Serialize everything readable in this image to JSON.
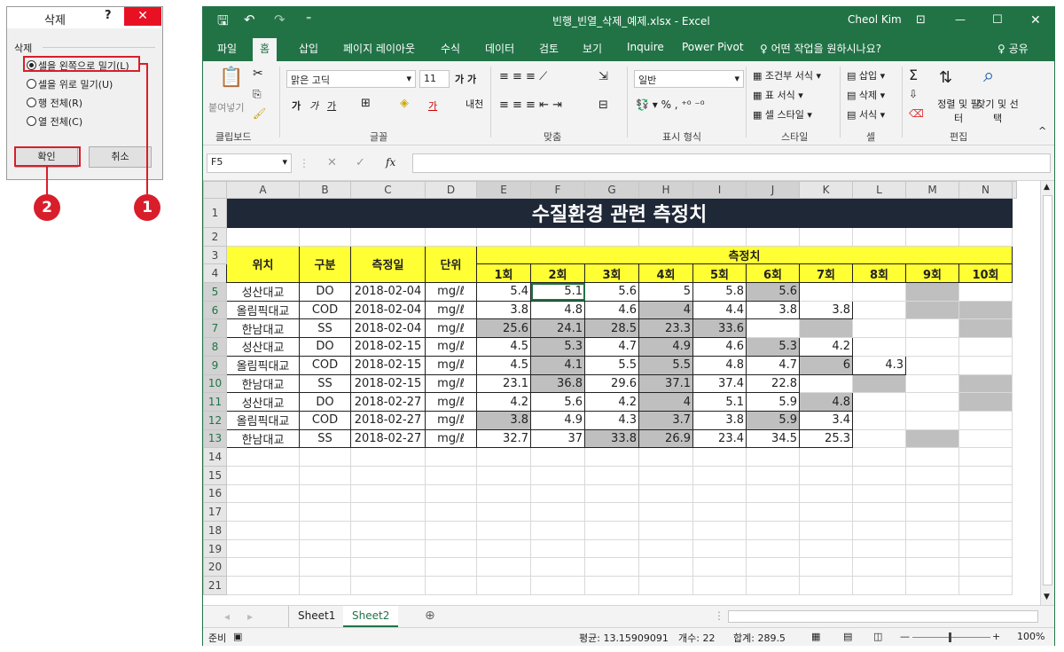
{
  "dialog": {
    "title": "삭제",
    "help": "?",
    "close": "✕",
    "group": "삭제",
    "options": [
      {
        "label": "셀을 왼쪽으로 밀기(L)",
        "selected": true
      },
      {
        "label": "셀을 위로 밀기(U)",
        "selected": false
      },
      {
        "label": "행 전체(R)",
        "selected": false
      },
      {
        "label": "열 전체(C)",
        "selected": false
      }
    ],
    "ok": "확인",
    "cancel": "취소"
  },
  "callouts": {
    "one": "1",
    "two": "2"
  },
  "app": {
    "title": "빈행_빈열_삭제_예제.xlsx  -  Excel",
    "user": "Cheol Kim"
  },
  "tabs": [
    "파일",
    "홈",
    "삽입",
    "페이지 레이아웃",
    "수식",
    "데이터",
    "검토",
    "보기",
    "Inquire",
    "Power Pivot",
    "♀ 어떤 작업을 원하시나요?"
  ],
  "share": "♀ 공유",
  "ribbon": {
    "clipboard": {
      "paste": "붙여넣기",
      "label": "클립보드"
    },
    "font": {
      "name": "맑은 고딕",
      "size": "11",
      "label": "글꼴"
    },
    "align": {
      "label": "맞춤"
    },
    "number": {
      "format": "일반",
      "label": "표시 형식"
    },
    "styles": {
      "conditional": "조건부 서식",
      "table": "표 서식",
      "cell": "셀 스타일",
      "label": "스타일"
    },
    "cells": {
      "insert": "삽입",
      "delete": "삭제",
      "format": "서식",
      "label": "셀"
    },
    "edit": {
      "sort": "정렬 및 필터",
      "find": "찾기 및 선택",
      "label": "편집"
    }
  },
  "formula": {
    "namebox": "F5",
    "value": ""
  },
  "columns": [
    "A",
    "B",
    "C",
    "D",
    "E",
    "F",
    "G",
    "H",
    "I",
    "J",
    "K",
    "L",
    "M",
    "N"
  ],
  "sheet": {
    "title": "수질환경 관련 측정치",
    "headers": {
      "loc": "위치",
      "type": "구분",
      "date": "측정일",
      "unit": "단위",
      "group": "측정치",
      "rounds": [
        "1회",
        "2회",
        "3회",
        "4회",
        "5회",
        "6회",
        "7회",
        "8회",
        "9회",
        "10회"
      ]
    },
    "rows": [
      {
        "loc": "성산대교",
        "type": "DO",
        "date": "2018-02-04",
        "unit": "mg/ℓ",
        "vals": [
          "5.4",
          "5.1",
          "5.6",
          "5",
          "5.8",
          "5.6",
          "",
          "",
          "",
          ""
        ]
      },
      {
        "loc": "올림픽대교",
        "type": "COD",
        "date": "2018-02-04",
        "unit": "mg/ℓ",
        "vals": [
          "3.8",
          "4.8",
          "4.6",
          "4",
          "4.4",
          "3.8",
          "3.8",
          "",
          "",
          ""
        ]
      },
      {
        "loc": "한남대교",
        "type": "SS",
        "date": "2018-02-04",
        "unit": "mg/ℓ",
        "vals": [
          "25.6",
          "24.1",
          "28.5",
          "23.3",
          "33.6",
          "",
          "",
          "",
          "",
          ""
        ]
      },
      {
        "loc": "성산대교",
        "type": "DO",
        "date": "2018-02-15",
        "unit": "mg/ℓ",
        "vals": [
          "4.5",
          "5.3",
          "4.7",
          "4.9",
          "4.6",
          "5.3",
          "4.2",
          "",
          "",
          ""
        ]
      },
      {
        "loc": "올림픽대교",
        "type": "COD",
        "date": "2018-02-15",
        "unit": "mg/ℓ",
        "vals": [
          "4.5",
          "4.1",
          "5.5",
          "5.5",
          "4.8",
          "4.7",
          "6",
          "4.3",
          "",
          ""
        ]
      },
      {
        "loc": "한남대교",
        "type": "SS",
        "date": "2018-02-15",
        "unit": "mg/ℓ",
        "vals": [
          "23.1",
          "36.8",
          "29.6",
          "37.1",
          "37.4",
          "22.8",
          "",
          "",
          "",
          ""
        ]
      },
      {
        "loc": "성산대교",
        "type": "DO",
        "date": "2018-02-27",
        "unit": "mg/ℓ",
        "vals": [
          "4.2",
          "5.6",
          "4.2",
          "4",
          "5.1",
          "5.9",
          "4.8",
          "",
          "",
          ""
        ]
      },
      {
        "loc": "올림픽대교",
        "type": "COD",
        "date": "2018-02-27",
        "unit": "mg/ℓ",
        "vals": [
          "3.8",
          "4.9",
          "4.3",
          "3.7",
          "3.8",
          "5.9",
          "3.4",
          "",
          "",
          ""
        ]
      },
      {
        "loc": "한남대교",
        "type": "SS",
        "date": "2018-02-27",
        "unit": "mg/ℓ",
        "vals": [
          "32.7",
          "37",
          "33.8",
          "26.9",
          "23.4",
          "34.5",
          "25.3",
          "",
          "",
          ""
        ]
      }
    ]
  },
  "sheets": [
    "Sheet1",
    "Sheet2"
  ],
  "status": {
    "ready": "준비",
    "average": "평균: 13.15909091",
    "count": "개수: 22",
    "sum": "합계: 289.5",
    "zoom": "100%"
  }
}
